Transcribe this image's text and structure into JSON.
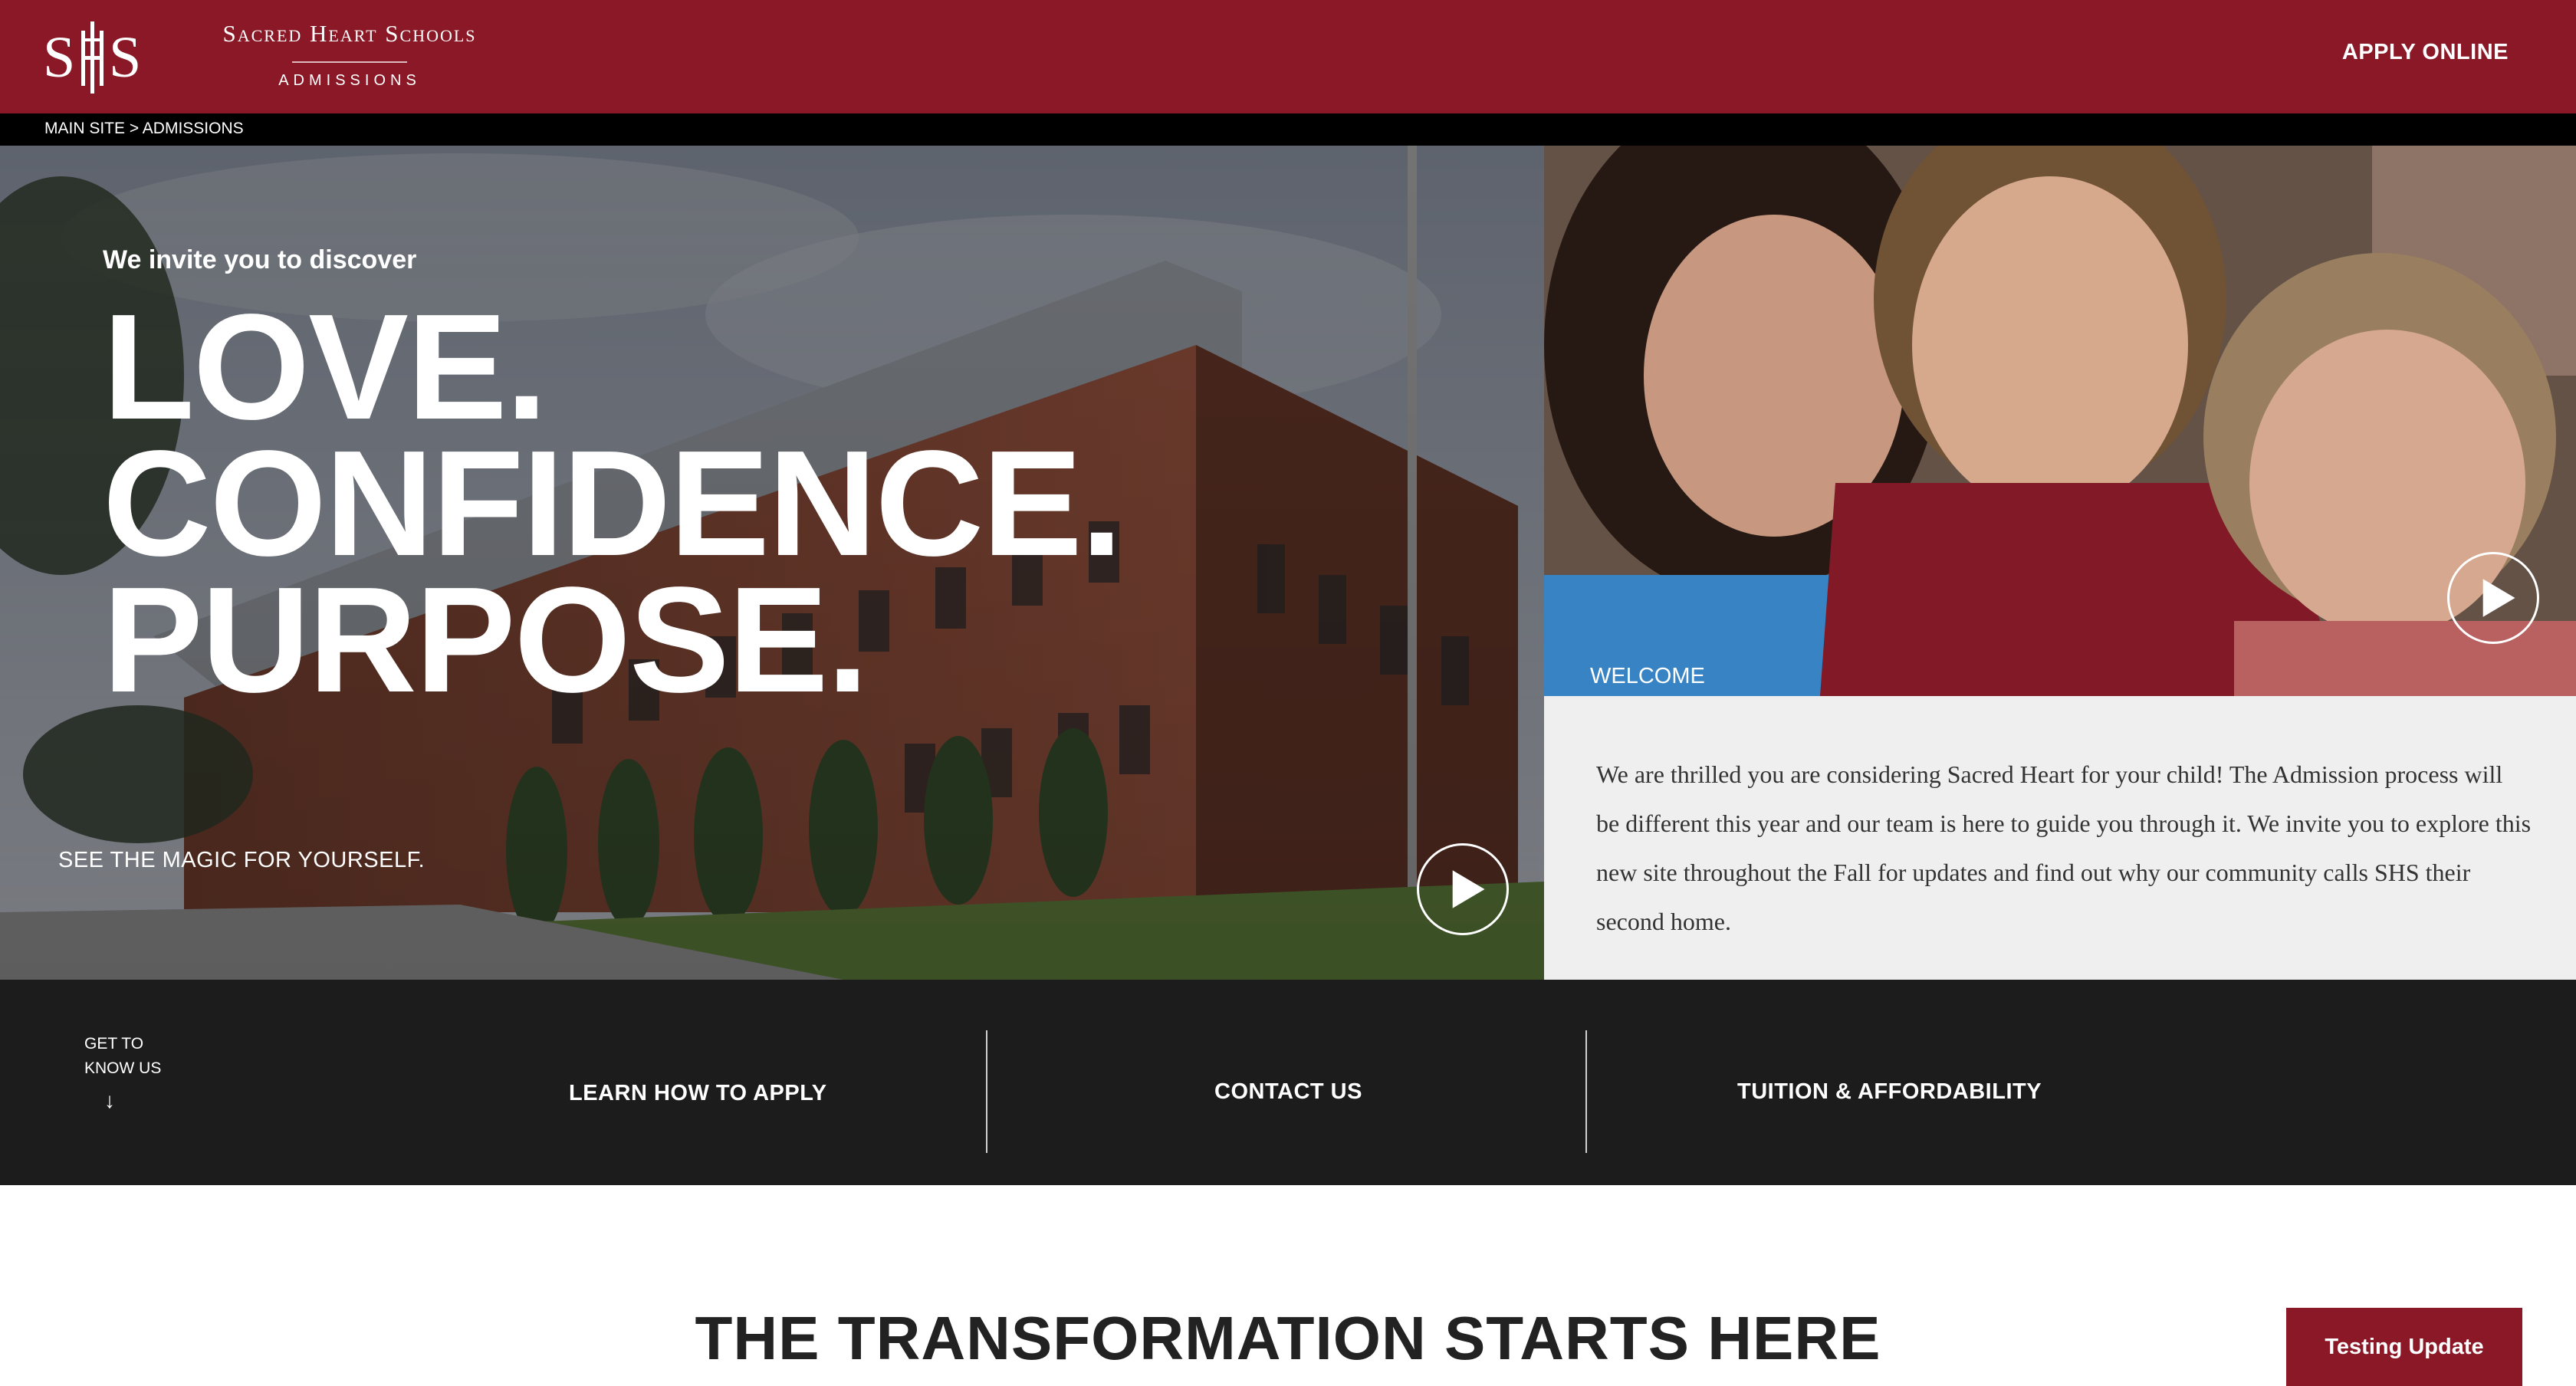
{
  "header": {
    "logo_monogram": "SHS",
    "school_name": "Sacred Heart Schools",
    "subtitle": "ADMISSIONS",
    "apply_label": "APPLY ONLINE"
  },
  "breadcrumb": {
    "text": "MAIN SITE > ADMISSIONS"
  },
  "hero": {
    "invite": "We invite you to discover",
    "headline_1": "LOVE.",
    "headline_2": "CONFIDENCE.",
    "headline_3": "PURPOSE.",
    "magic": "SEE THE MAGIC FOR YOURSELF."
  },
  "welcome": {
    "label": "WELCOME",
    "text": "We are thrilled you are considering Sacred Heart for your child! The Admission process will be different this year and our team is here to guide you through it. We invite you to explore this new site throughout the Fall for updates and find out why our community calls SHS their second home."
  },
  "nav": {
    "get_to_know_1": "GET TO",
    "get_to_know_2": "KNOW US",
    "arrow": "↓",
    "learn": "LEARN HOW TO APPLY",
    "contact": "CONTACT US",
    "tuition": "TUITION & AFFORDABILITY"
  },
  "section": {
    "title": "THE TRANSFORMATION STARTS HERE"
  },
  "floating": {
    "testing_label": "Testing Update"
  },
  "colors": {
    "brand": "#8a1826",
    "nav_bg": "#1c1c1c",
    "welcome_bg": "#efefef"
  }
}
